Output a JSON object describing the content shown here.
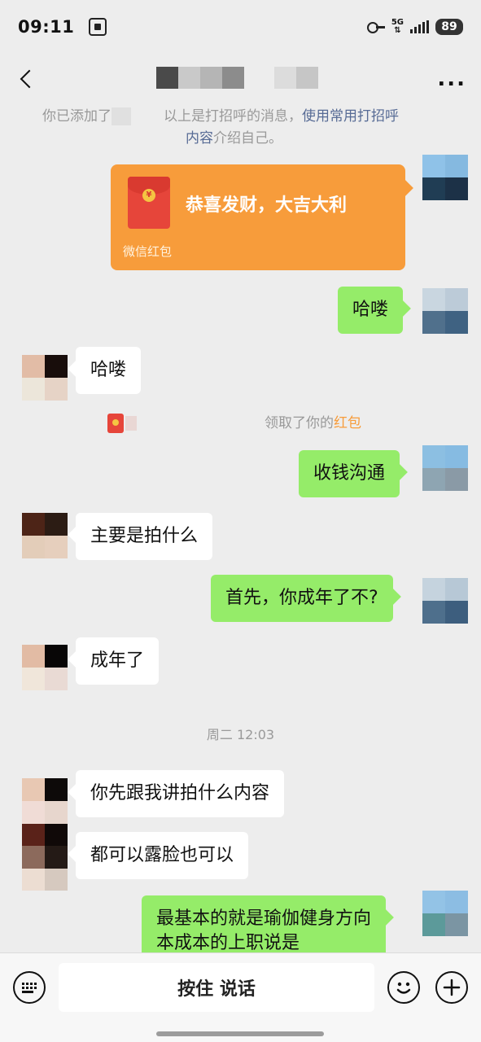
{
  "status_bar": {
    "time": "09:11",
    "network": "5G",
    "battery": "89"
  },
  "nav": {
    "back_label": "<",
    "more_label": "..."
  },
  "chat": {
    "system_notice_line1_a": "你已添加了",
    "system_notice_line1_b": "以上是打招呼的消息，",
    "system_notice_link_a": "使用常用打招呼",
    "system_notice_link_b": "内容",
    "system_notice_line2_rest": "介绍自己。",
    "red_packet": {
      "greeting": "恭喜发财，大吉大利",
      "label": "微信红包"
    },
    "msg_hello_me": "哈喽",
    "msg_hello_other": "哈喽",
    "received_note": "领取了你的",
    "received_highlight": "红包",
    "msg_money": "收钱沟通",
    "msg_what_shoot": "主要是拍什么",
    "msg_adult_q": "首先，你成年了不?",
    "msg_adult_a": "成年了",
    "timestamp": "周二 12:03",
    "msg_tell_me": "你先跟我讲拍什么内容",
    "msg_face": "都可以露脸也可以",
    "msg_basic_line1": "最基本的就是瑜伽健身方向",
    "msg_basic_line2": "本成本的上职说是"
  },
  "input_bar": {
    "hold_to_talk": "按住 说话"
  },
  "colors": {
    "background": "#ededed",
    "my_bubble": "#95ec69",
    "other_bubble": "#ffffff",
    "red_packet": "#f79c3b",
    "link": "#576b95"
  },
  "icons": [
    "scan-icon",
    "key-icon",
    "signal-icon",
    "battery-icon",
    "back-icon",
    "more-icon",
    "red-envelope-icon",
    "keyboard-icon",
    "emoji-icon",
    "plus-icon"
  ]
}
